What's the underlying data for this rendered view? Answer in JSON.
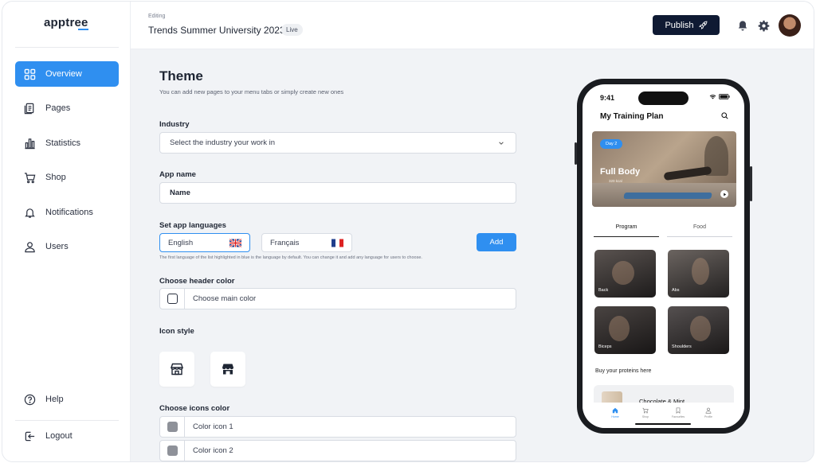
{
  "brand": {
    "logo_text": "apptree",
    "accent": "#2f8ff0",
    "dark": "#0f1a33"
  },
  "sidebar": {
    "items": [
      {
        "label": "Overview",
        "icon": "grid-icon",
        "active": true
      },
      {
        "label": "Pages",
        "icon": "pages-icon"
      },
      {
        "label": "Statistics",
        "icon": "chart-bars-icon"
      },
      {
        "label": "Shop",
        "icon": "cart-icon"
      },
      {
        "label": "Notifications",
        "icon": "bell-icon"
      },
      {
        "label": "Users",
        "icon": "user-icon"
      }
    ],
    "help": "Help",
    "logout": "Logout"
  },
  "header": {
    "editing_label": "Editing",
    "project_title": "Trends Summer University 2023",
    "status_badge": "Live",
    "publish_label": "Publish",
    "icons": [
      "bell-icon",
      "gear-icon",
      "avatar"
    ]
  },
  "form": {
    "title": "Theme",
    "subtitle": "You can add new pages to your menu tabs or simply create new ones",
    "industry": {
      "label": "Industry",
      "placeholder": "Select the industry your work in"
    },
    "app_name": {
      "label": "App name",
      "value": "Name"
    },
    "languages": {
      "label": "Set app languages",
      "items": [
        {
          "name": "English",
          "flag": "uk-flag-icon"
        },
        {
          "name": "Français",
          "flag": "france-flag-icon"
        }
      ],
      "add_label": "Add",
      "hint": "The first language of the list highlighted in blue is the language by default. You can change it and add any language for users to choose."
    },
    "header_color": {
      "label": "Choose header color",
      "placeholder": "Choose main color"
    },
    "icon_style": {
      "label": "Icon style",
      "options": [
        "store-outline-icon",
        "store-filled-icon"
      ]
    },
    "icons_color": {
      "label": "Choose icons color",
      "items": [
        "Color icon 1",
        "Color icon 2"
      ],
      "swatch": "#8e9199"
    }
  },
  "phone": {
    "time": "9:41",
    "app_title": "My Training Plan",
    "hero": {
      "badge": "Day 2",
      "title": "Full Body",
      "kcal": "320 kcal"
    },
    "tabs": [
      "Program",
      "Food"
    ],
    "categories": [
      "Back",
      "Abs",
      "Biceps",
      "Shoulders"
    ],
    "proteins_label": "Buy your proteins here",
    "product_name": "Chocolate & Mint",
    "bottom_nav": [
      "Home",
      "Shop",
      "Favourites",
      "Profile"
    ]
  }
}
